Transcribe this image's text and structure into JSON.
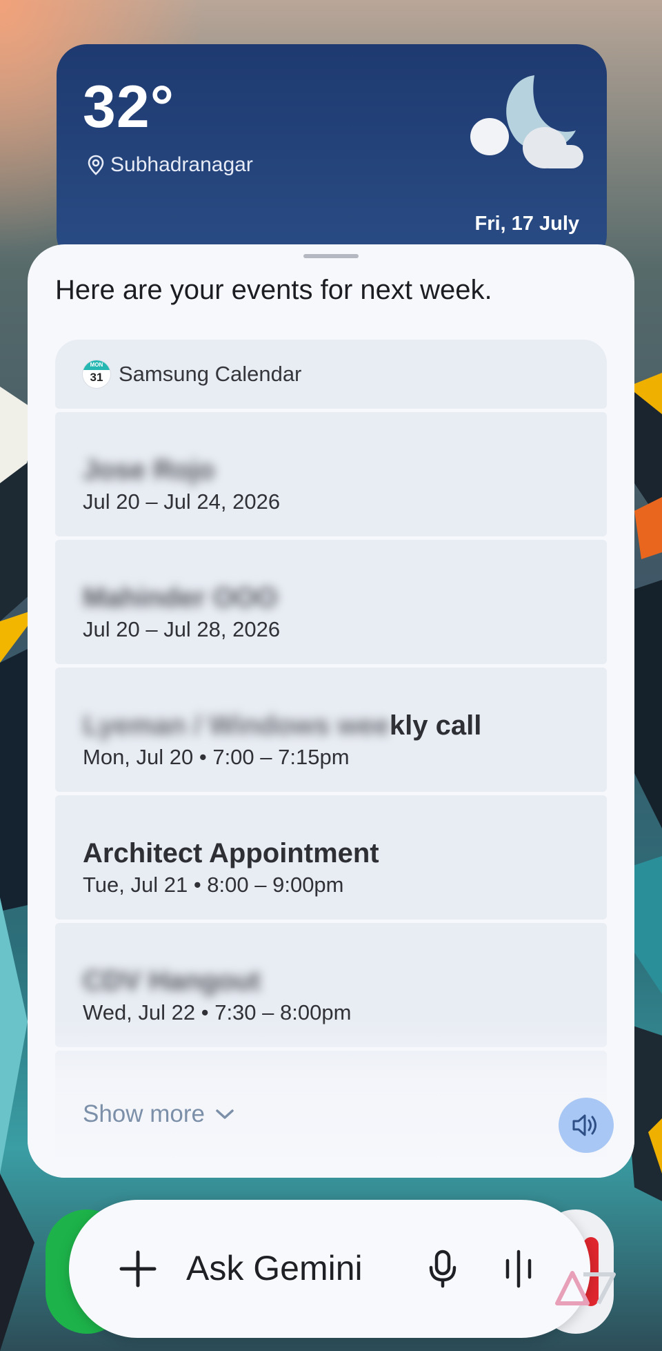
{
  "weather": {
    "temperature": "32°",
    "location": "Subhadranagar",
    "date": "Fri, 17 July",
    "condition_icon": "moon-cloud-icon",
    "location_icon": "location-pin-icon"
  },
  "assistant": {
    "message": "Here are your events for next week."
  },
  "calendar": {
    "app_name": "Samsung Calendar",
    "icon_day": "MON",
    "icon_date": "31",
    "events": [
      {
        "title": "Jose Rojo",
        "time": "Jul 20 – Jul 24, 2026",
        "blurred": true
      },
      {
        "title": "Mahinder OOO",
        "time": "Jul 20 – Jul 28, 2026",
        "blurred": true
      },
      {
        "title_hidden": "Lyeman / Windows wee",
        "title_visible": "kly call",
        "time": "Mon, Jul 20 • 7:00 – 7:15pm",
        "blurred": true
      },
      {
        "title": "Architect Appointment",
        "time": "Tue, Jul 21 • 8:00 – 9:00pm",
        "blurred": false
      },
      {
        "title": "CDV Hangout",
        "time": "Wed, Jul 22 • 7:30 – 8:00pm",
        "blurred": true
      }
    ],
    "show_more_label": "Show more"
  },
  "input_bar": {
    "placeholder": "Ask Gemini",
    "add_icon": "plus-icon",
    "mic_icon": "microphone-icon",
    "live_icon": "waveform-icon"
  },
  "colors": {
    "weather_card": "#1e3a70",
    "sheet_bg": "#f7f8fc",
    "event_bg": "#e8ecf3",
    "show_more": "#7b8fa8",
    "speak_button": "#a8c7f4"
  }
}
